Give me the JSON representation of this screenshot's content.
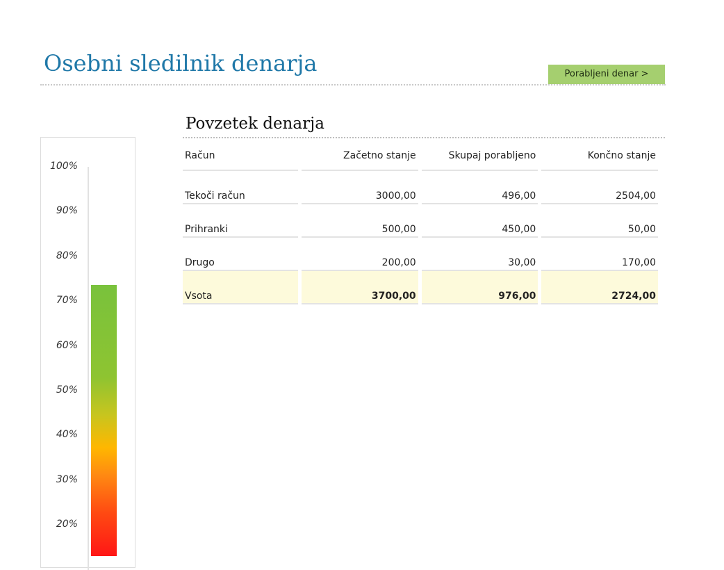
{
  "header": {
    "title": "Osebni sledilnik denarja",
    "nav_button": "Porabljeni denar >"
  },
  "gauge": {
    "ticks": [
      "100%",
      "90%",
      "80%",
      "70%",
      "60%",
      "50%",
      "40%",
      "30%",
      "20%"
    ],
    "level_percent": 73.6,
    "colors": {
      "high": "#79c23c",
      "mid": "#ffb700",
      "low": "#ff1616"
    }
  },
  "summary": {
    "title": "Povzetek denarja",
    "columns": [
      "Račun",
      "Začetno stanje",
      "Skupaj porabljeno",
      "Končno stanje"
    ],
    "rows": [
      {
        "account": "Tekoči račun",
        "start": "3000,00",
        "spent": "496,00",
        "end": "2504,00"
      },
      {
        "account": "Prihranki",
        "start": "500,00",
        "spent": "450,00",
        "end": "50,00"
      },
      {
        "account": "Drugo",
        "start": "200,00",
        "spent": "30,00",
        "end": "170,00"
      }
    ],
    "total": {
      "account": "Vsota",
      "start": "3700,00",
      "spent": "976,00",
      "end": "2724,00"
    }
  },
  "colors": {
    "title": "#1f78a8",
    "button": "#a5cf6f",
    "total_row": "#fdfadb"
  }
}
